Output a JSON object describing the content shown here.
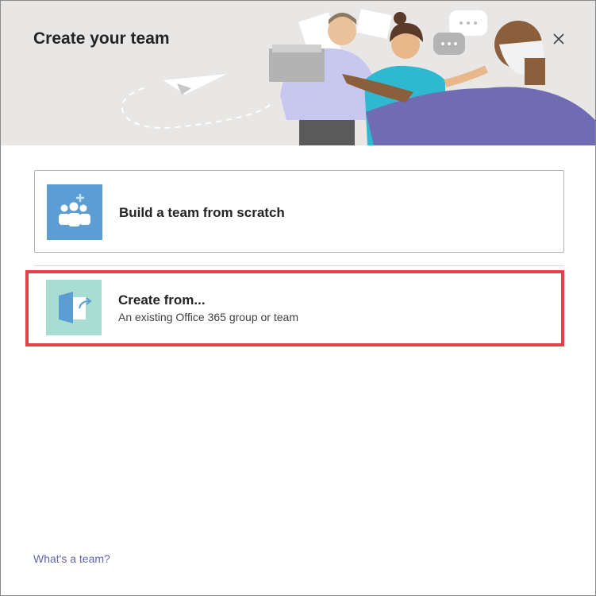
{
  "dialog": {
    "title": "Create your team",
    "close_icon": "close-icon"
  },
  "options": [
    {
      "title": "Build a team from scratch",
      "icon": "team-add-icon"
    },
    {
      "title": "Create from...",
      "subtitle": "An existing Office 365 group or team",
      "icon": "open-existing-icon"
    }
  ],
  "footer": {
    "link": "What's a team?"
  },
  "colors": {
    "accent": "#6264a7",
    "highlight": "#e5404a",
    "tile_blue": "#5c9ed4",
    "tile_teal": "#a8ddd2"
  }
}
